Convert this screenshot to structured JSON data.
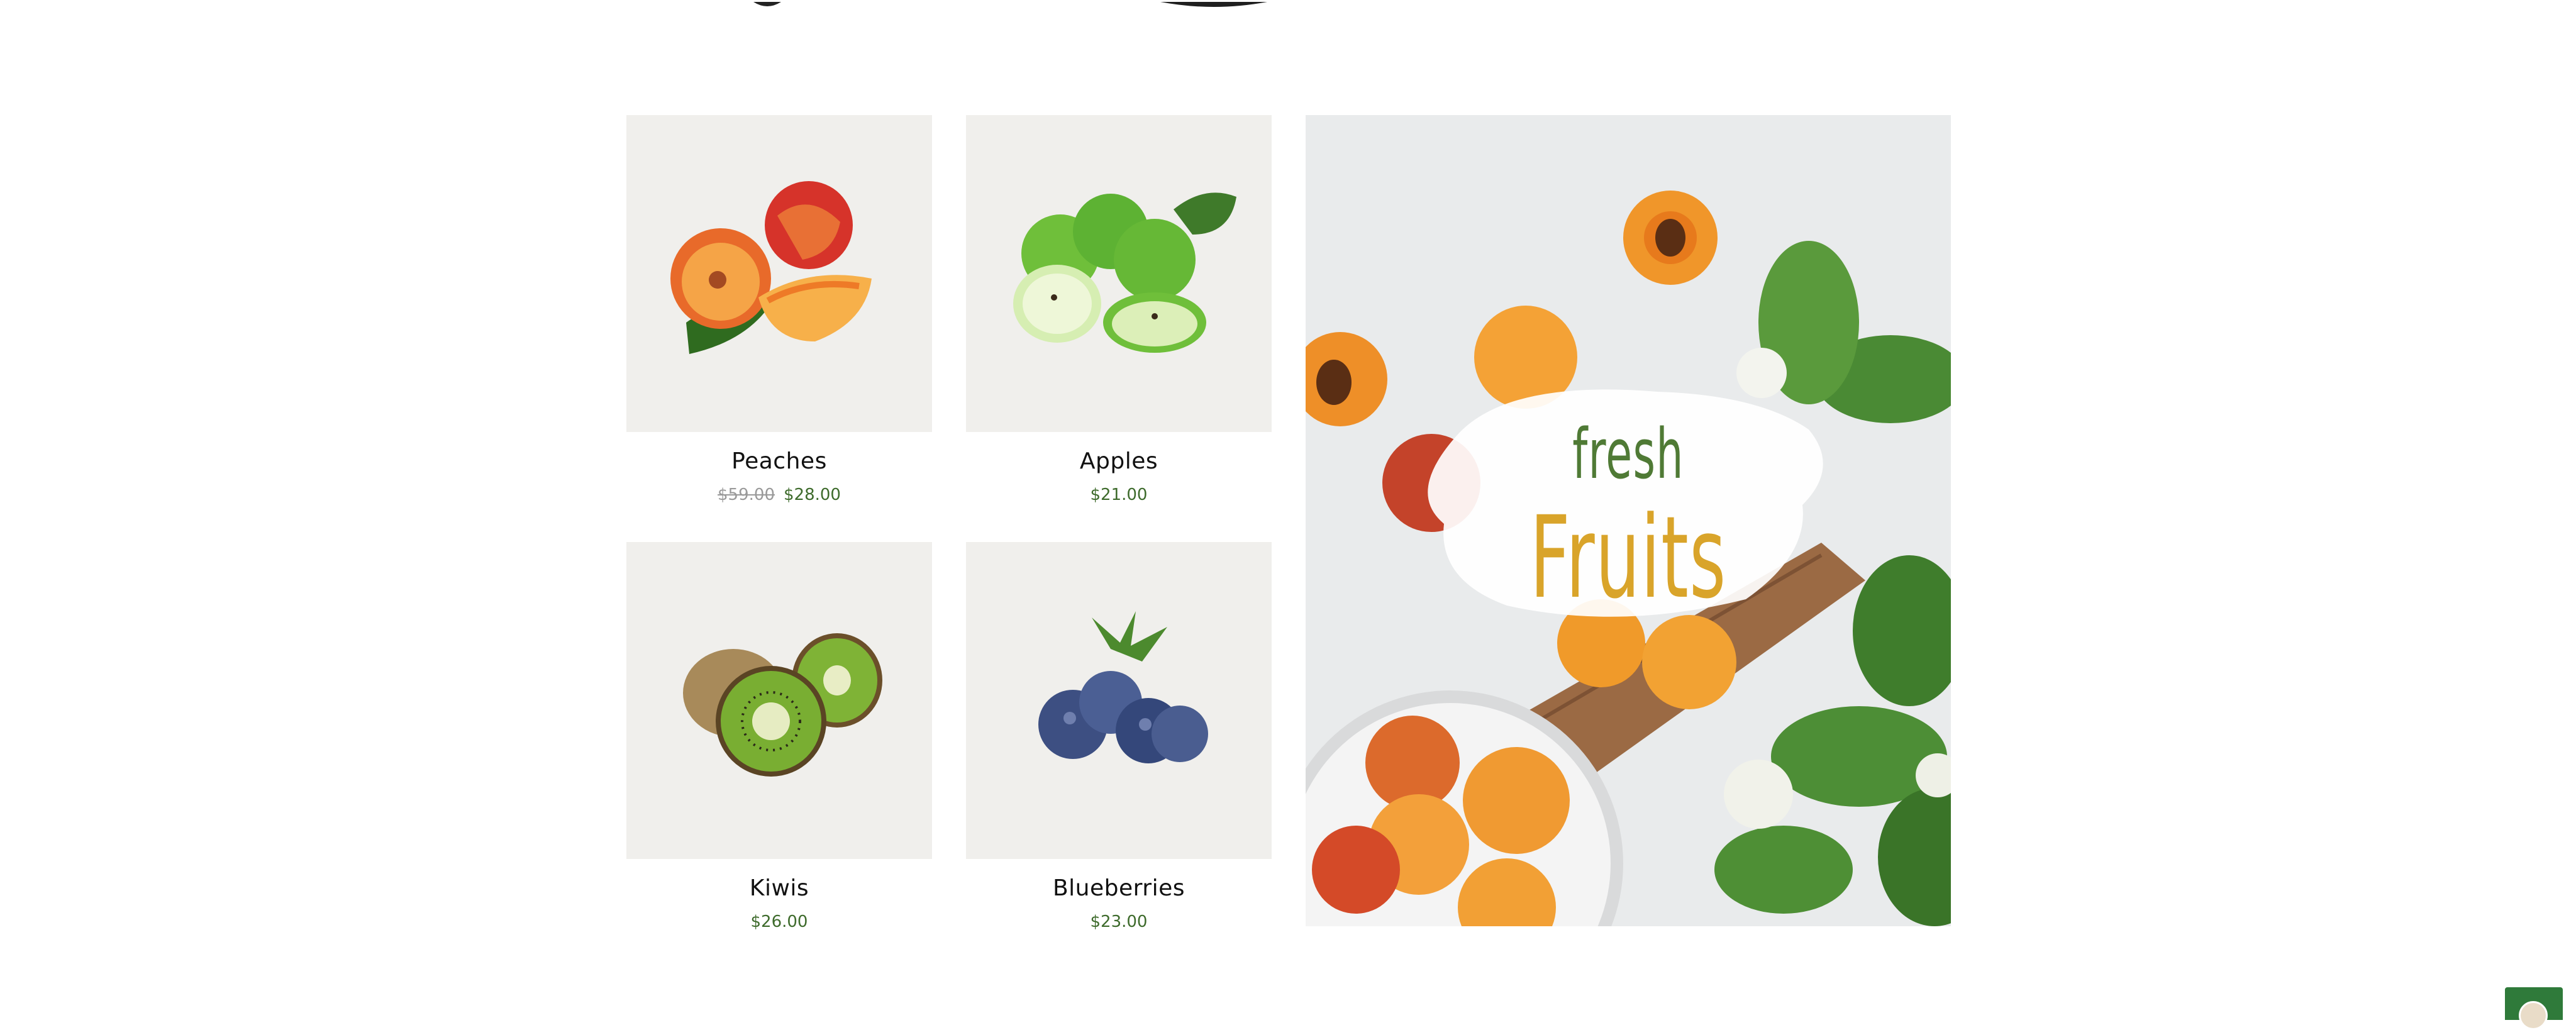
{
  "products": [
    {
      "name": "Peaches",
      "price_old": "$59.00",
      "price": "$28.00",
      "image_icon": "peach-icon"
    },
    {
      "name": "Apples",
      "price_old": "",
      "price": "$21.00",
      "image_icon": "apple-icon"
    },
    {
      "name": "Kiwis",
      "price_old": "",
      "price": "$26.00",
      "image_icon": "kiwi-icon"
    },
    {
      "name": "Blueberries",
      "price_old": "",
      "price": "$23.00",
      "image_icon": "blueberry-icon"
    }
  ],
  "banner": {
    "line1": "fresh",
    "line2": "Fruits",
    "image_icon": "fruit-banner-image"
  },
  "chat_widget": {
    "icon": "chat-avatar-icon"
  },
  "colors": {
    "price_green": "#3e6b2c",
    "old_price_gray": "#9a9a9a",
    "card_bg": "#f0efec",
    "banner_green": "#4f7a35",
    "banner_gold": "#d9a42a",
    "widget_green": "#2f7a3a"
  }
}
